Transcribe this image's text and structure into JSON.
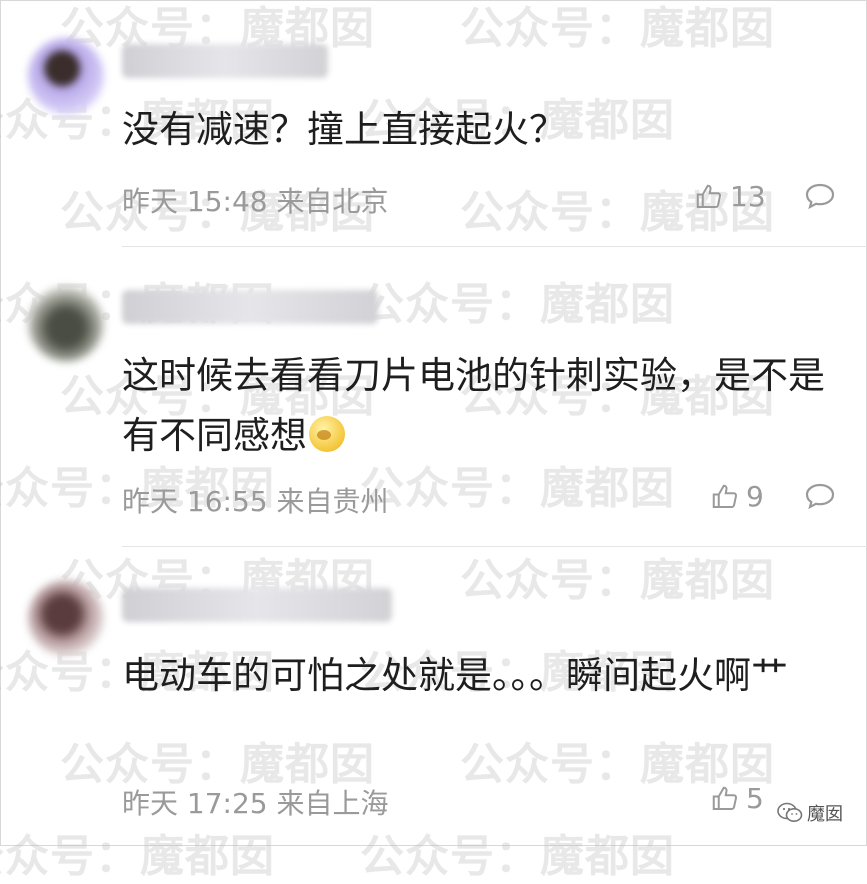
{
  "watermark": "公众号：魔都囡",
  "comments": [
    {
      "text": "没有减速？撞上直接起火？",
      "meta": "昨天 15:48 来自北京",
      "likes": "13",
      "avatar_color": "#9aa6f2"
    },
    {
      "text": "这时候去看看刀片电池的针刺实验，是不是有不同感想",
      "meta": "昨天 16:55 来自贵州",
      "likes": "9",
      "avatar_color": "#6b6f63"
    },
    {
      "text": "电动车的可怕之处就是。。。瞬间起火啊艹",
      "meta": "昨天 17:25 来自上海",
      "likes": "5",
      "avatar_color": "#9a7c80"
    }
  ],
  "brand": {
    "label": "魔囡",
    "icon": "wechat-icon"
  }
}
